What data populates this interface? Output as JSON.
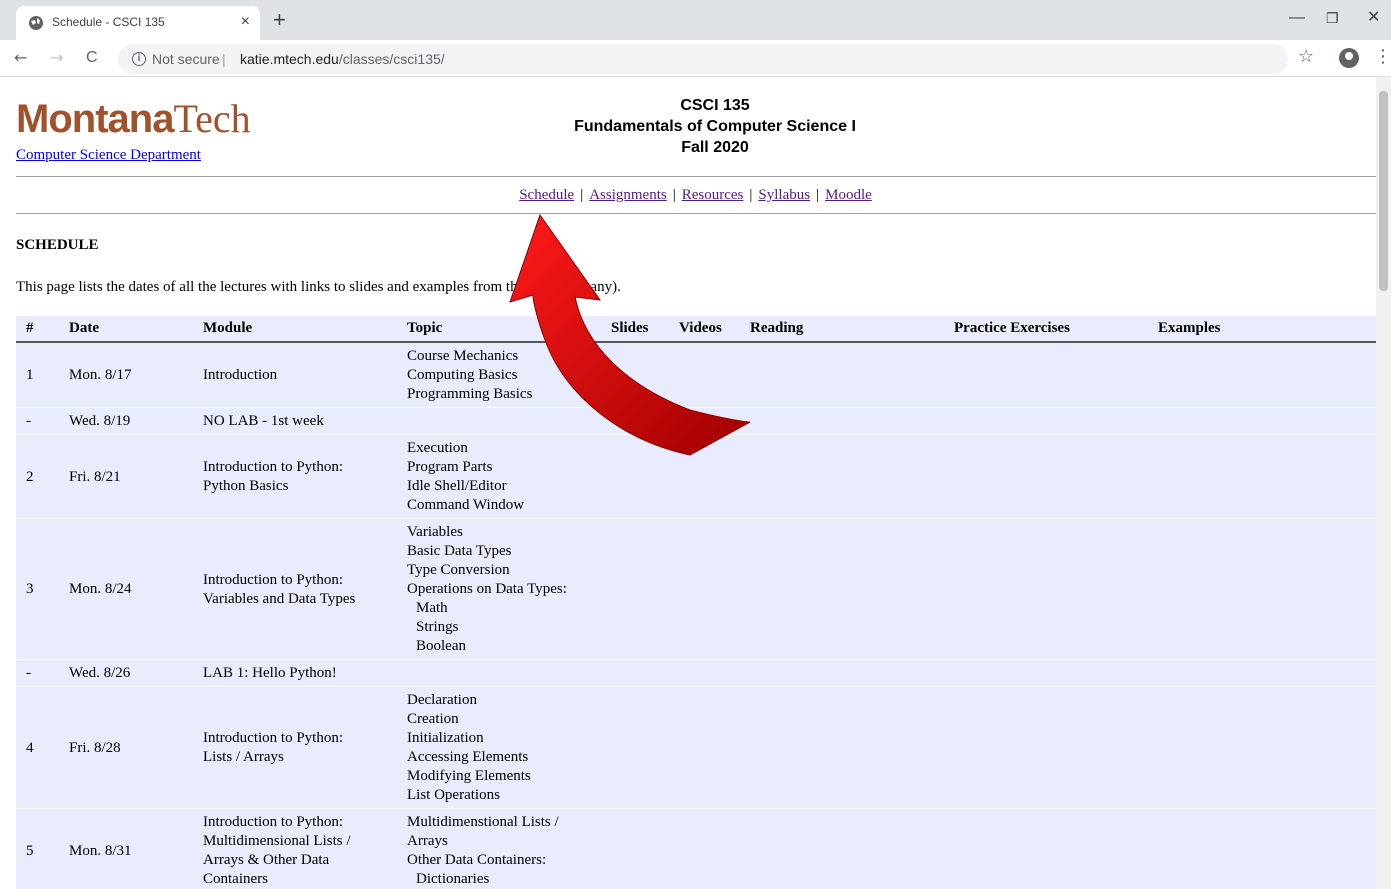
{
  "browser": {
    "tab_title": "Schedule - CSCI 135",
    "tab_close": "×",
    "new_tab": "+",
    "back": "←",
    "forward": "→",
    "reload": "C",
    "security": "Not secure",
    "url_host": "katie.mtech.edu",
    "url_path": "/classes/csci135/",
    "bookmark": "☆",
    "menu": "⋮",
    "minimize": "—",
    "restore": "❐",
    "close": "✕"
  },
  "header": {
    "logo_main": "Montana",
    "logo_tech": "Tech",
    "dept_link": "Computer Science Department",
    "course_code": "CSCI 135",
    "course_name": "Fundamentals of Computer Science I",
    "term": "Fall 2020"
  },
  "nav": {
    "schedule": "Schedule",
    "assignments": "Assignments",
    "resources": "Resources",
    "syllabus": "Syllabus",
    "moodle": "Moodle",
    "sep": "|"
  },
  "section_title": "SCHEDULE",
  "intro": "This page lists the dates of all the lectures with links to slides and examples from the lecture (if any).",
  "table": {
    "headers": [
      "#",
      "Date",
      "Module",
      "Topic",
      "Slides",
      "Videos",
      "Reading",
      "Practice Exercises",
      "Examples"
    ],
    "rows": [
      {
        "num": "1",
        "date": "Mon. 8/17",
        "module": [
          "Introduction"
        ],
        "topic": [
          "Course Mechanics",
          "Computing Basics",
          "Programming Basics"
        ]
      },
      {
        "num": "-",
        "date": "Wed. 8/19",
        "module": [
          "NO LAB - 1st week"
        ],
        "topic": []
      },
      {
        "num": "2",
        "date": "Fri. 8/21",
        "module": [
          "Introduction to Python:",
          "Python Basics"
        ],
        "topic": [
          "Execution",
          "Program Parts",
          "Idle Shell/Editor",
          "Command Window"
        ]
      },
      {
        "num": "3",
        "date": "Mon. 8/24",
        "module": [
          "Introduction to Python:",
          "Variables and Data Types"
        ],
        "topic": [
          "Variables",
          "Basic Data Types",
          "Type Conversion",
          "Operations on Data Types:",
          "  Math",
          "  Strings",
          "  Boolean"
        ]
      },
      {
        "num": "-",
        "date": "Wed. 8/26",
        "module": [
          "LAB 1: Hello Python!"
        ],
        "topic": []
      },
      {
        "num": "4",
        "date": "Fri. 8/28",
        "module": [
          "Introduction to Python:",
          "Lists / Arrays"
        ],
        "topic": [
          "Declaration",
          "Creation",
          "Initialization",
          "Accessing Elements",
          "Modifying Elements",
          "List Operations"
        ]
      },
      {
        "num": "5",
        "date": "Mon. 8/31",
        "module": [
          "Introduction to Python:",
          "Multidimensional Lists /",
          "Arrays & Other Data",
          "Containers"
        ],
        "topic": [
          "Multidimenstional Lists /",
          "Arrays",
          "Other Data Containers:",
          "  Dictionaries"
        ]
      }
    ]
  },
  "colors": {
    "table_bg": "#e8ecfc",
    "logo": "#a0522d",
    "link": "#551a8b",
    "arrow": "#d40000"
  }
}
